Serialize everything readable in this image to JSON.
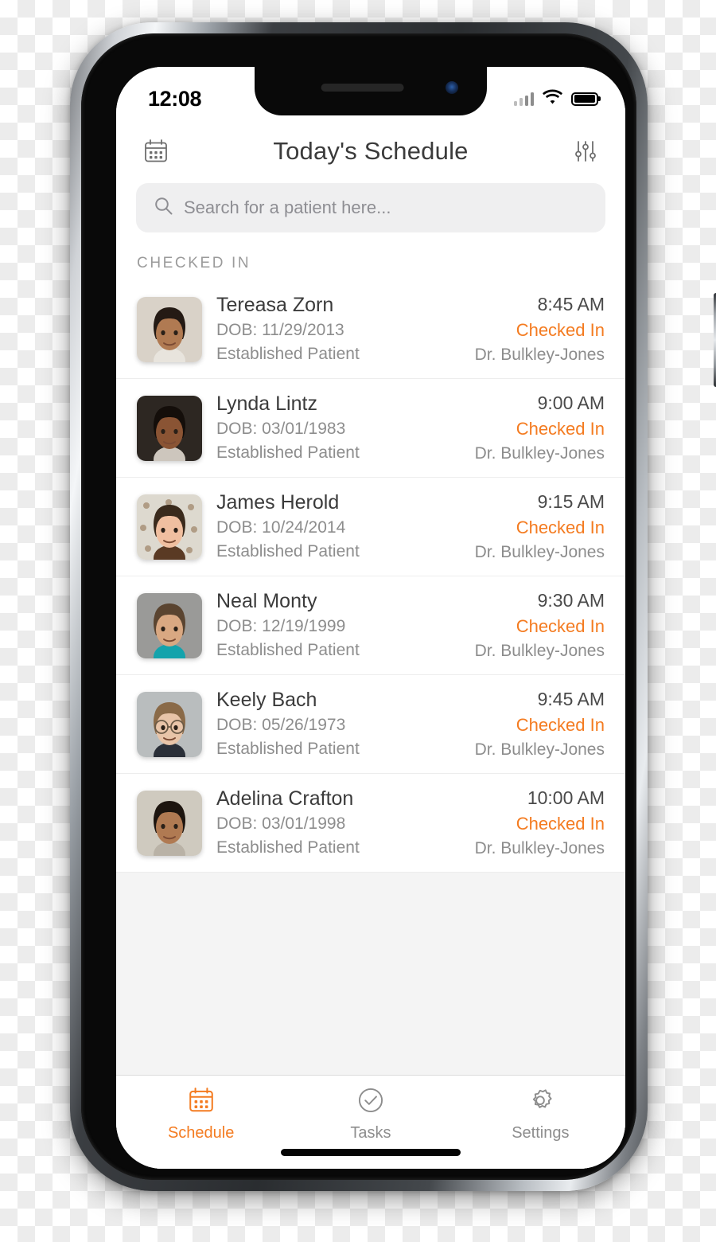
{
  "status_bar": {
    "time": "12:08",
    "signal_icon": "cellular-signal-icon",
    "wifi_icon": "wifi-icon",
    "battery_icon": "battery-full-icon"
  },
  "header": {
    "title": "Today's Schedule",
    "left_icon": "calendar-icon",
    "right_icon": "filter-sliders-icon"
  },
  "search": {
    "placeholder": "Search for a patient here...",
    "value": "",
    "icon": "search-icon"
  },
  "section": {
    "label": "CHECKED IN"
  },
  "colors": {
    "accent": "#F47B20",
    "text_primary": "#3B3B3B",
    "text_secondary": "#8D8D8D",
    "search_bg": "#EFEFF0",
    "filler_bg": "#F4F4F4",
    "divider": "#EDEDED"
  },
  "patients": [
    {
      "name": "Tereasa Zorn",
      "dob": "DOB: 11/29/2013",
      "type": "Established Patient",
      "time": "8:45 AM",
      "status": "Checked In",
      "doctor": "Dr. Bulkley-Jones",
      "avatar": "avatar-tereasa-zorn"
    },
    {
      "name": "Lynda Lintz",
      "dob": "DOB: 03/01/1983",
      "type": "Established Patient",
      "time": "9:00 AM",
      "status": "Checked In",
      "doctor": "Dr. Bulkley-Jones",
      "avatar": "avatar-lynda-lintz"
    },
    {
      "name": "James Herold",
      "dob": "DOB: 10/24/2014",
      "type": "Established Patient",
      "time": "9:15 AM",
      "status": "Checked In",
      "doctor": "Dr. Bulkley-Jones",
      "avatar": "avatar-james-herold"
    },
    {
      "name": "Neal Monty",
      "dob": "DOB: 12/19/1999",
      "type": "Established Patient",
      "time": "9:30 AM",
      "status": "Checked In",
      "doctor": "Dr. Bulkley-Jones",
      "avatar": "avatar-neal-monty"
    },
    {
      "name": "Keely Bach",
      "dob": "DOB: 05/26/1973",
      "type": "Established Patient",
      "time": "9:45 AM",
      "status": "Checked In",
      "doctor": "Dr. Bulkley-Jones",
      "avatar": "avatar-keely-bach"
    },
    {
      "name": "Adelina Crafton",
      "dob": "DOB: 03/01/1998",
      "type": "Established Patient",
      "time": "10:00 AM",
      "status": "Checked In",
      "doctor": "Dr. Bulkley-Jones",
      "avatar": "avatar-adelina-crafton"
    }
  ],
  "tab_bar": {
    "items": [
      {
        "label": "Schedule",
        "icon": "calendar-icon",
        "active": true
      },
      {
        "label": "Tasks",
        "icon": "check-circle-icon",
        "active": false
      },
      {
        "label": "Settings",
        "icon": "gear-icon",
        "active": false
      }
    ]
  }
}
